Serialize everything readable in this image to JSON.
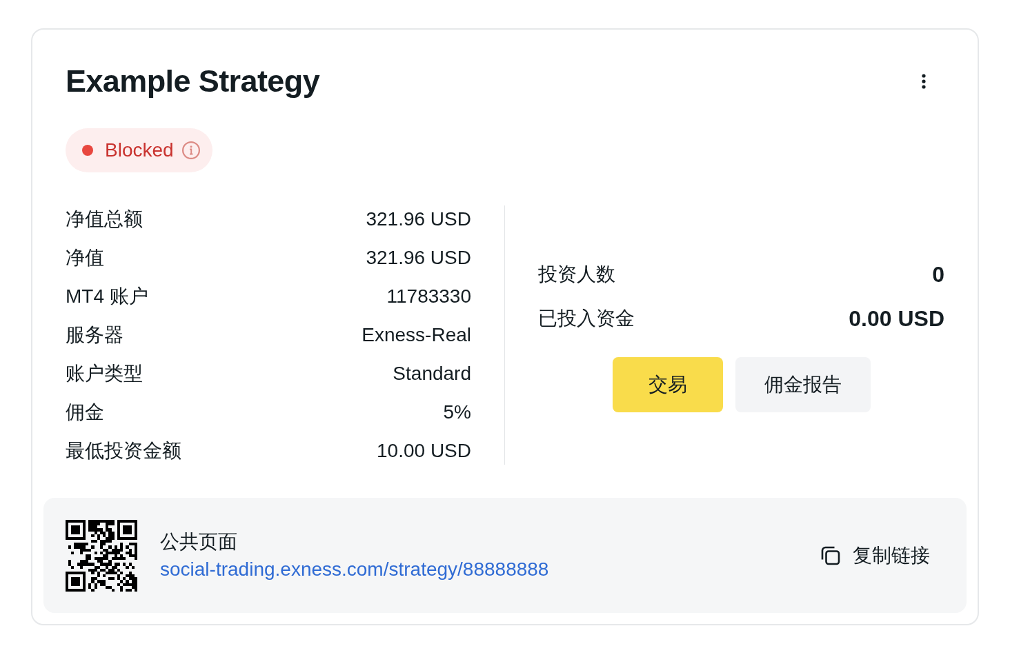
{
  "card": {
    "title": "Example Strategy"
  },
  "status": {
    "label": "Blocked",
    "color": "#e8473f"
  },
  "stats": [
    {
      "label": "净值总额",
      "value": "321.96 USD"
    },
    {
      "label": "净值",
      "value": "321.96 USD"
    },
    {
      "label": "MT4 账户",
      "value": "11783330"
    },
    {
      "label": "服务器",
      "value": "Exness-Real"
    },
    {
      "label": "账户类型",
      "value": "Standard"
    },
    {
      "label": "佣金",
      "value": "5%"
    },
    {
      "label": "最低投资金额",
      "value": "10.00 USD"
    }
  ],
  "summary": [
    {
      "label": "投资人数",
      "value": "0"
    },
    {
      "label": "已投入资金",
      "value": "0.00 USD"
    }
  ],
  "actions": [
    {
      "label": "交易",
      "kind": "primary"
    },
    {
      "label": "佣金报告",
      "kind": "secondary"
    }
  ],
  "public_page": {
    "label": "公共页面",
    "link": "social-trading.exness.com/strategy/88888888",
    "copy_label": "复制链接"
  }
}
